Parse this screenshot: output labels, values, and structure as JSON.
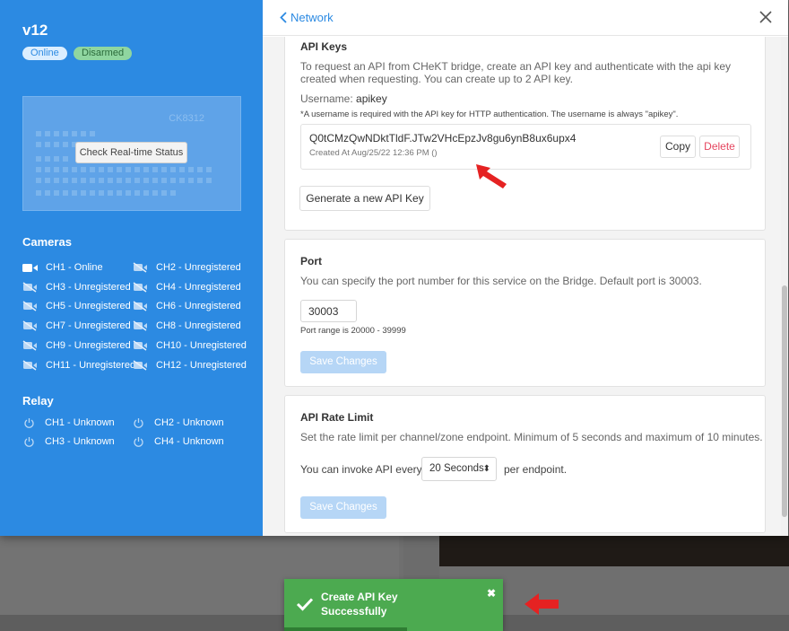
{
  "device": {
    "name": "v12",
    "status_online": "Online",
    "status_armed": "Disarmed",
    "model": "CK8312",
    "check_status_label": "Check Real-time Status"
  },
  "cameras": {
    "title": "Cameras",
    "items": [
      {
        "label": "CH1 - Online",
        "state": "online"
      },
      {
        "label": "CH2 - Unregistered",
        "state": "unregistered"
      },
      {
        "label": "CH3 - Unregistered",
        "state": "unregistered"
      },
      {
        "label": "CH4 - Unregistered",
        "state": "unregistered"
      },
      {
        "label": "CH5 - Unregistered",
        "state": "unregistered"
      },
      {
        "label": "CH6 - Unregistered",
        "state": "unregistered"
      },
      {
        "label": "CH7 - Unregistered",
        "state": "unregistered"
      },
      {
        "label": "CH8 - Unregistered",
        "state": "unregistered"
      },
      {
        "label": "CH9 - Unregistered",
        "state": "unregistered"
      },
      {
        "label": "CH10 - Unregistered",
        "state": "unregistered"
      },
      {
        "label": "CH11 - Unregistered",
        "state": "unregistered"
      },
      {
        "label": "CH12 - Unregistered",
        "state": "unregistered"
      }
    ]
  },
  "relay": {
    "title": "Relay",
    "items": [
      {
        "label": "CH1 - Unknown"
      },
      {
        "label": "CH2 - Unknown"
      },
      {
        "label": "CH3 - Unknown"
      },
      {
        "label": "CH4 - Unknown"
      }
    ]
  },
  "header": {
    "back_label": "Network",
    "close_icon": "close-icon"
  },
  "api_keys": {
    "title": "API Keys",
    "description": "To request an API from CHeKT bridge, create an API key and authenticate with the api key created when requesting. You can create up to 2 API key.",
    "username_label": "Username:",
    "username_value": "apikey",
    "note": "*A username is required with the API key for HTTP authentication. The username is always \"apikey\".",
    "key": {
      "value": "Q0tCMzQwNDktTldF.JTw2VHcEpzJv8gu6ynB8ux6upx4",
      "created": "Created At Aug/25/22 12:36 PM ()",
      "copy_label": "Copy",
      "delete_label": "Delete"
    },
    "generate_label": "Generate a new API Key"
  },
  "port": {
    "title": "Port",
    "description": "You can specify the port number for this service on the Bridge. Default port is 30003.",
    "value": "30003",
    "range_note": "Port range is 20000 - 39999",
    "save_label": "Save Changes"
  },
  "rate_limit": {
    "title": "API Rate Limit",
    "description": "Set the rate limit per channel/zone endpoint. Minimum of 5 seconds and maximum of 10 minutes.",
    "prefix": "You can invoke API every",
    "selected": "20 Seconds",
    "suffix": "per endpoint.",
    "save_label": "Save Changes"
  },
  "toast": {
    "title": "Create API Key",
    "subtitle": "Successfully",
    "progress": 0.56
  },
  "colors": {
    "sidebar": "#2c8ae2",
    "accent": "#2c8ae2",
    "toast": "#4caa50",
    "delete": "#e5465f",
    "arrow": "#e52222"
  }
}
